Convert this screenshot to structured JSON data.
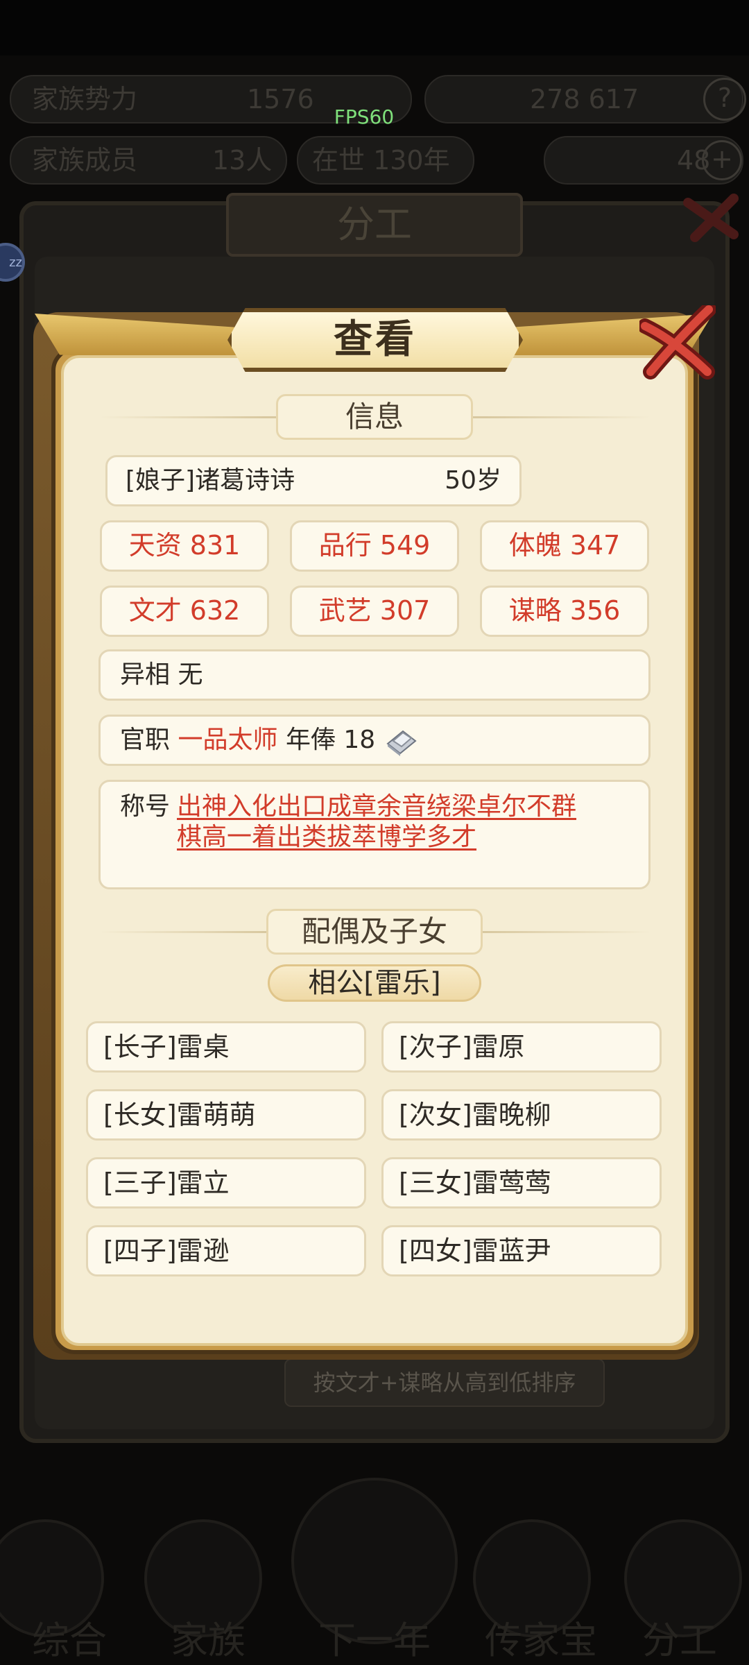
{
  "background": {
    "stats_row1": {
      "left_label": "家族势力",
      "left_value": "1576",
      "right_values": "278 617"
    },
    "stats_row2": {
      "left_label": "家族成员",
      "left_value": "13人",
      "middle": "在世 130年",
      "right_value": "48"
    },
    "fps": "FPS60",
    "panel_title": "分工",
    "sort_label": "按文才+谋略从高到低排序",
    "nav": [
      "综合",
      "家族",
      "下一年",
      "传家宝",
      "分工"
    ]
  },
  "modal": {
    "title": "查看",
    "info_section": "信息",
    "person": {
      "name": "[娘子]诸葛诗诗",
      "age": "50岁"
    },
    "stats": [
      {
        "label": "天资 831"
      },
      {
        "label": "品行 549"
      },
      {
        "label": "体魄 347"
      },
      {
        "label": "文才 632"
      },
      {
        "label": "武艺 307"
      },
      {
        "label": "谋略 356"
      }
    ],
    "trait": {
      "label": "异相",
      "value": "无"
    },
    "office": {
      "label": "官职",
      "title": "一品太师",
      "salary_label": "年俸",
      "salary_value": "18"
    },
    "honors": {
      "label": "称号",
      "line1": "出神入化出口成章余音绕梁卓尔不群",
      "line2": "棋高一着出类拔萃博学多才"
    },
    "family_section": "配偶及子女",
    "spouse": "相公[雷乐]",
    "children": [
      "[长子]雷桌",
      "[次子]雷原",
      "[长女]雷萌萌",
      "[次女]雷晚柳",
      "[三子]雷立",
      "[三女]雷莺莺",
      "[四子]雷逊",
      "[四女]雷蓝尹"
    ]
  },
  "colors": {
    "accent_red": "#d23c2a",
    "paper": "#f5edd4",
    "gold": "#c89b4a"
  },
  "icons": [
    "silver-ingot-icon",
    "close-icon",
    "question-icon",
    "plus-icon"
  ]
}
